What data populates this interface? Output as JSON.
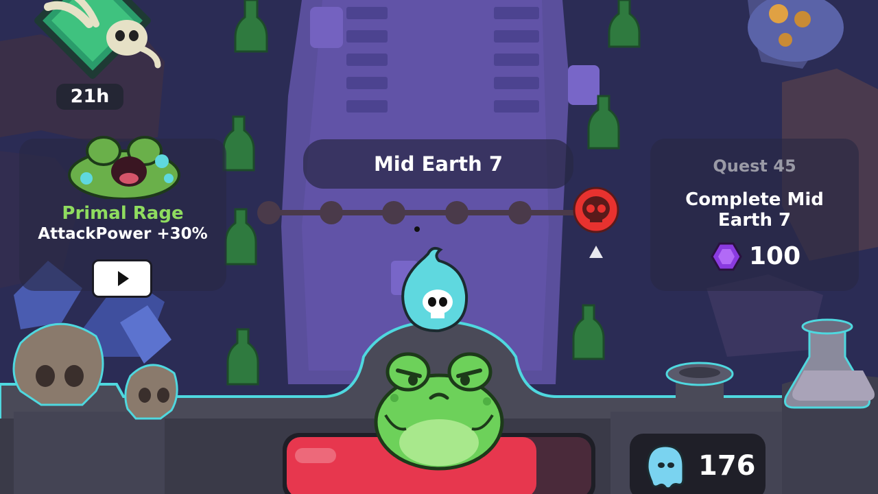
{
  "event": {
    "timer": "21h"
  },
  "boost": {
    "name": "Primal Rage",
    "effect": "AttackPower +30%",
    "play_icon": "play-icon"
  },
  "level": {
    "name": "Mid Earth 7",
    "nodes_total": 5,
    "boss_icon": "red-skull-icon"
  },
  "quest": {
    "title": "Quest 45",
    "line1": "Complete Mid",
    "line2": "Earth 7",
    "reward": "100",
    "reward_icon": "purple-gem-icon"
  },
  "player": {
    "health_fraction": 0.82,
    "bubble_icon": "skull-flame-icon"
  },
  "souls": {
    "count": "176",
    "icon": "ghost-soul-icon"
  },
  "colors": {
    "accent": "#4fd8df",
    "boost_name": "#8fdc5f",
    "health": "#e7374e",
    "gem": "#8a3be0",
    "boss": "#e8322f"
  }
}
